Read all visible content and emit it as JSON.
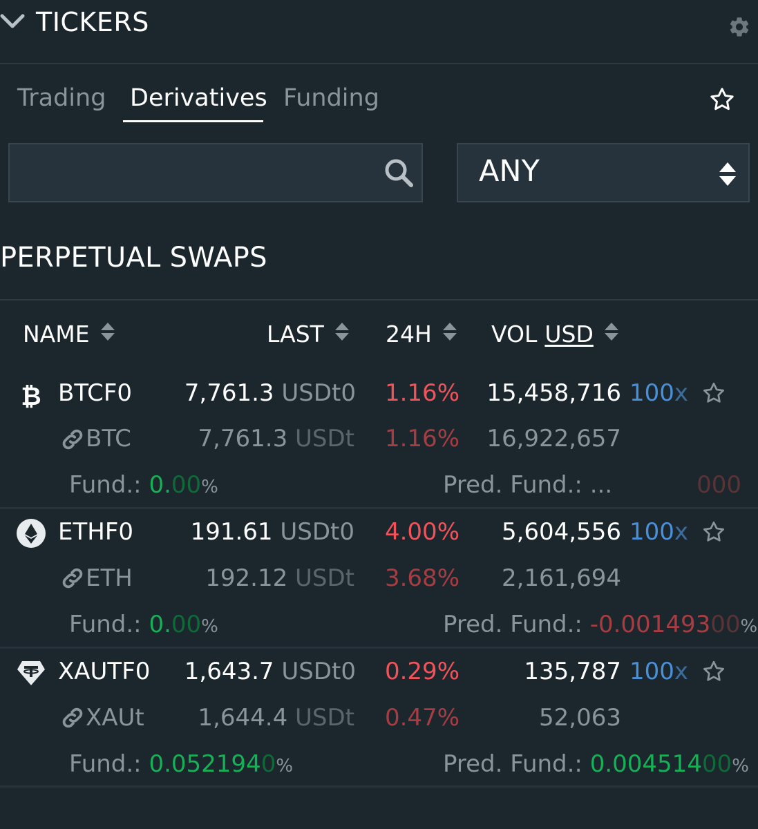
{
  "header": {
    "title": "TICKERS"
  },
  "tabs": [
    {
      "label": "Trading"
    },
    {
      "label": "Derivatives"
    },
    {
      "label": "Funding"
    }
  ],
  "search": {
    "value": ""
  },
  "filter": {
    "selected": "ANY"
  },
  "section": {
    "title": "PERPETUAL SWAPS"
  },
  "columns": {
    "name": "NAME",
    "last": "LAST",
    "change": "24H",
    "vol": "VOL",
    "vol_unit": "USD"
  },
  "rows": [
    {
      "icon": "bitcoin-icon",
      "symbol": "BTCF0",
      "last": "7,761.3",
      "last_unit": "USDt0",
      "change": "1.16%",
      "volume": "15,458,716",
      "leverage_main": "100",
      "leverage_suffix": "x",
      "ref_symbol": "BTC",
      "ref_last": "7,761.3",
      "ref_unit": "USDt",
      "ref_change": "1.16%",
      "ref_volume": "16,922,657",
      "fund_label": "Fund.:",
      "fund_main": "0.",
      "fund_trail": "00",
      "fund_pct": "%",
      "pred_label": "Pred. Fund.:",
      "pred_value": "...",
      "pred_trail": "000"
    },
    {
      "icon": "ethereum-icon",
      "symbol": "ETHF0",
      "last": "191.61",
      "last_unit": "USDt0",
      "change": "4.00%",
      "volume": "5,604,556",
      "leverage_main": "100",
      "leverage_suffix": "x",
      "ref_symbol": "ETH",
      "ref_last": "192.12",
      "ref_unit": "USDt",
      "ref_change": "3.68%",
      "ref_volume": "2,161,694",
      "fund_label": "Fund.:",
      "fund_main": "0.",
      "fund_trail": "00",
      "fund_pct": "%",
      "pred_label": "Pred. Fund.:",
      "pred_main": "-0.001493",
      "pred_trail": "00",
      "pred_pct": "%"
    },
    {
      "icon": "tether-gold-icon",
      "symbol": "XAUTF0",
      "last": "1,643.7",
      "last_unit": "USDt0",
      "change": "0.29%",
      "volume": "135,787",
      "leverage_main": "100",
      "leverage_suffix": "x",
      "ref_symbol": "XAUt",
      "ref_last": "1,644.4",
      "ref_unit": "USDt",
      "ref_change": "0.47%",
      "ref_volume": "52,063",
      "fund_label": "Fund.:",
      "fund_main": "0.052194",
      "fund_trail": "0",
      "fund_pct": "%",
      "pred_label": "Pred. Fund.:",
      "pred_main": "0.004514",
      "pred_trail": "00",
      "pred_pct": "%"
    }
  ],
  "colors": {
    "background": "#1b262d",
    "negative": "#f05359",
    "positive": "#16b157",
    "accent": "#4a90d9"
  }
}
